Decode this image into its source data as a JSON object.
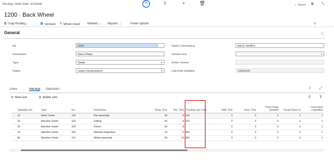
{
  "topbar": {
    "breadcrumb": "Routing | Work Date: 3/1/2026",
    "saved": "✓ Saved"
  },
  "page": {
    "title": "1200 · Back Wheel"
  },
  "actions": {
    "copy_routing": "Copy Routing...",
    "versions": "Versions",
    "where_used": "Where-Used",
    "related": "Related",
    "reports": "Reports",
    "fewer_options": "Fewer options"
  },
  "general": {
    "heading": "General",
    "no_label": "No.",
    "no_value": "1200",
    "description_label": "Description",
    "description_value": "Back Wheel",
    "type_label": "Type",
    "type_value": "Serial",
    "status_label": "Status",
    "status_value": "Under Development",
    "search_desc_label": "Search Description",
    "search_desc_value": "BACK WHEEL",
    "version_nos_label": "Version Nos.",
    "version_nos_value": "",
    "active_version_label": "Active Version",
    "active_version_value": "",
    "last_modified_label": "Last Date Modified",
    "last_modified_value": "1/30/2025"
  },
  "lines": {
    "tabs": [
      "Lines",
      "Manage",
      "Operation"
    ],
    "active_tab": "Manage",
    "new_line": "New Line",
    "delete_line": "Delete Line",
    "columns": [
      "Operation No.",
      "Type",
      "No.",
      "Description",
      "Setup Time",
      "Run Time",
      "Routing Link Code",
      "Wait Time",
      "Move Time",
      "Fixed Scrap Quantity",
      "Scrap Factor %",
      "Concurrent Capacities"
    ],
    "rows": [
      {
        "marker": "→",
        "op": "10",
        "type": "Work Center",
        "no": "100",
        "desc": "Rim assembly",
        "setup": "60",
        "run": "6",
        "link": "100",
        "wait": "0",
        "move": "0",
        "fixed": "0",
        "scrap": "0",
        "conc": "1"
      },
      {
        "marker": "",
        "op": "20",
        "type": "Machine Center",
        "no": "410",
        "desc": "Drilling",
        "setup": "60",
        "run": "8",
        "link": "200",
        "wait": "0",
        "move": "0",
        "fixed": "0",
        "scrap": "0",
        "conc": "1"
      },
      {
        "marker": "",
        "op": "30",
        "type": "Machine Center",
        "no": "420",
        "desc": "Deburr",
        "setup": "60",
        "run": "8",
        "link": "",
        "wait": "0",
        "move": "0",
        "fixed": "0",
        "scrap": "0",
        "conc": "1"
      },
      {
        "marker": "",
        "op": "40",
        "type": "Machine Center",
        "no": "440",
        "desc": "Machine inspection",
        "setup": "10",
        "run": "5",
        "link": "300",
        "wait": "0",
        "move": "0",
        "fixed": "0",
        "scrap": "0",
        "conc": "1"
      },
      {
        "marker": "",
        "op": "50",
        "type": "Machine Center",
        "no": "110",
        "desc": "Wheel assembly",
        "setup": "60",
        "run": "10",
        "link": "400",
        "wait": "0",
        "move": "0",
        "fixed": "0",
        "scrap": "0",
        "conc": "1"
      }
    ]
  }
}
